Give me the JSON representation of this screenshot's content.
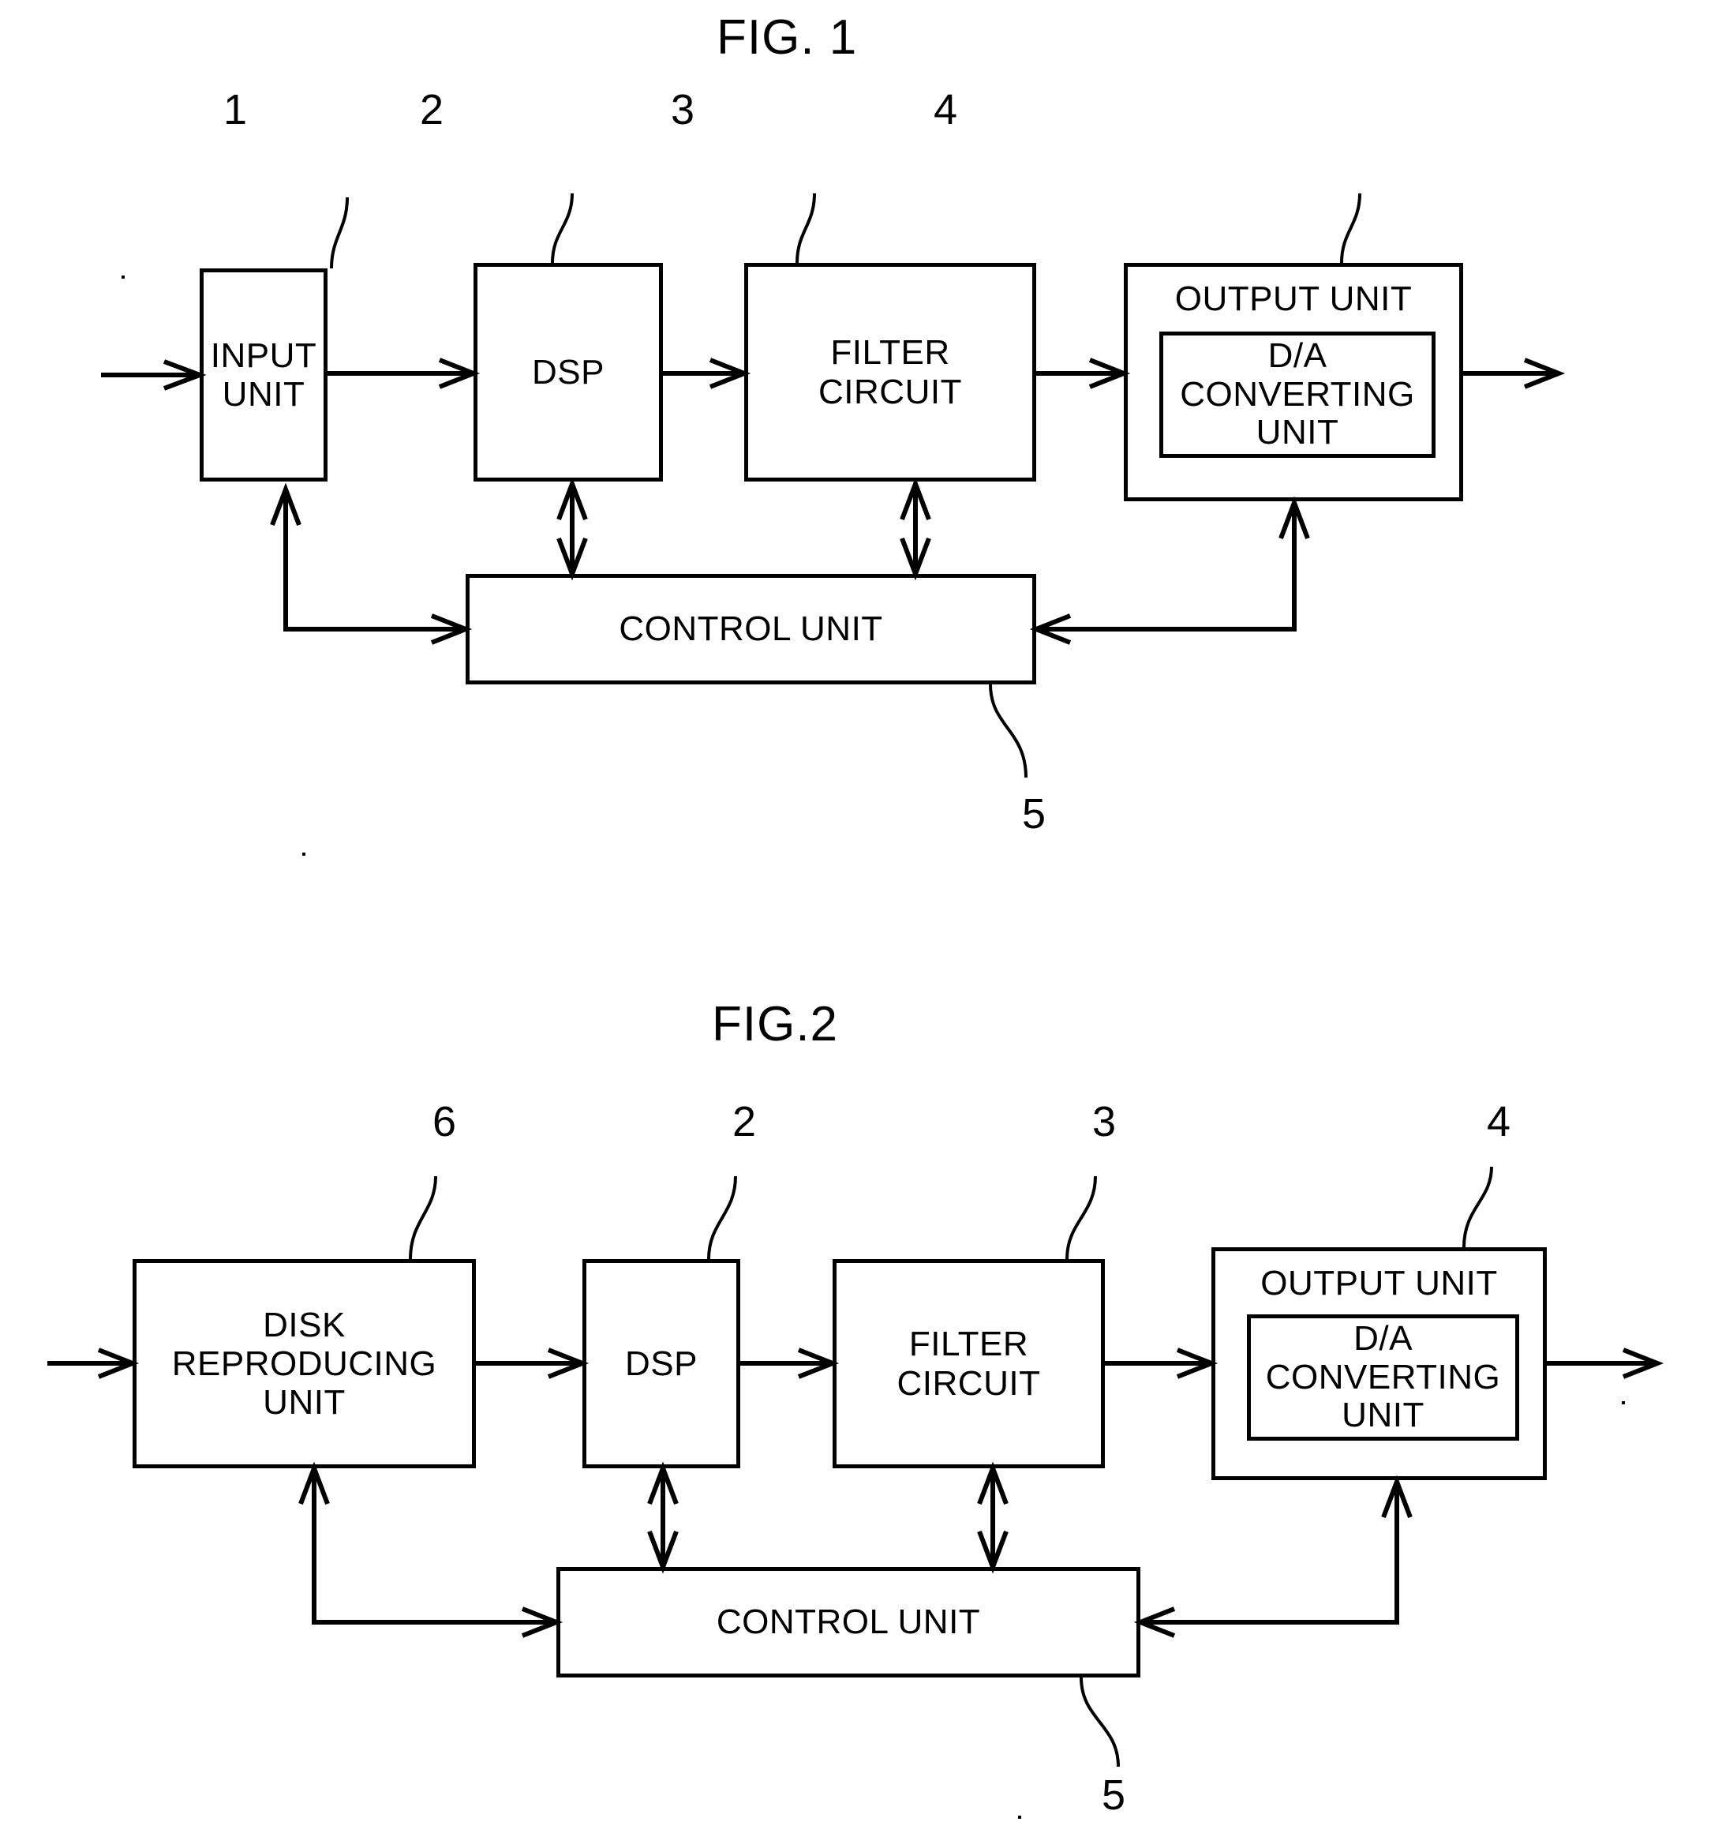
{
  "document": {
    "type": "patent-drawing-sheet",
    "background_color": "#ffffff",
    "line_color": "#000000"
  },
  "figures": [
    {
      "id": "fig1",
      "title": "FIG. 1",
      "blocks": [
        {
          "key": "input_unit",
          "label": "INPUT\nUNIT",
          "ref": "1"
        },
        {
          "key": "dsp",
          "label": "DSP",
          "ref": "2"
        },
        {
          "key": "filter_circuit",
          "label": "FILTER\nCIRCUIT",
          "ref": "3"
        },
        {
          "key": "output_unit",
          "label": "OUTPUT UNIT",
          "ref": "4"
        },
        {
          "key": "da_converting_unit",
          "label": "D/A\nCONVERTING\nUNIT",
          "ref": ""
        },
        {
          "key": "control_unit",
          "label": "CONTROL UNIT",
          "ref": "5"
        }
      ],
      "ref_numbers": [
        "1",
        "2",
        "3",
        "4",
        "5"
      ]
    },
    {
      "id": "fig2",
      "title": "FIG.2",
      "blocks": [
        {
          "key": "disk_reproducing_unit",
          "label": "DISK\nREPRODUCING\nUNIT",
          "ref": "6"
        },
        {
          "key": "dsp",
          "label": "DSP",
          "ref": "2"
        },
        {
          "key": "filter_circuit",
          "label": "FILTER\nCIRCUIT",
          "ref": "3"
        },
        {
          "key": "output_unit",
          "label": "OUTPUT UNIT",
          "ref": "4"
        },
        {
          "key": "da_converting_unit",
          "label": "D/A\nCONVERTING\nUNIT",
          "ref": ""
        },
        {
          "key": "control_unit",
          "label": "CONTROL UNIT",
          "ref": "5"
        }
      ],
      "ref_numbers": [
        "6",
        "2",
        "3",
        "4",
        "5"
      ]
    }
  ]
}
